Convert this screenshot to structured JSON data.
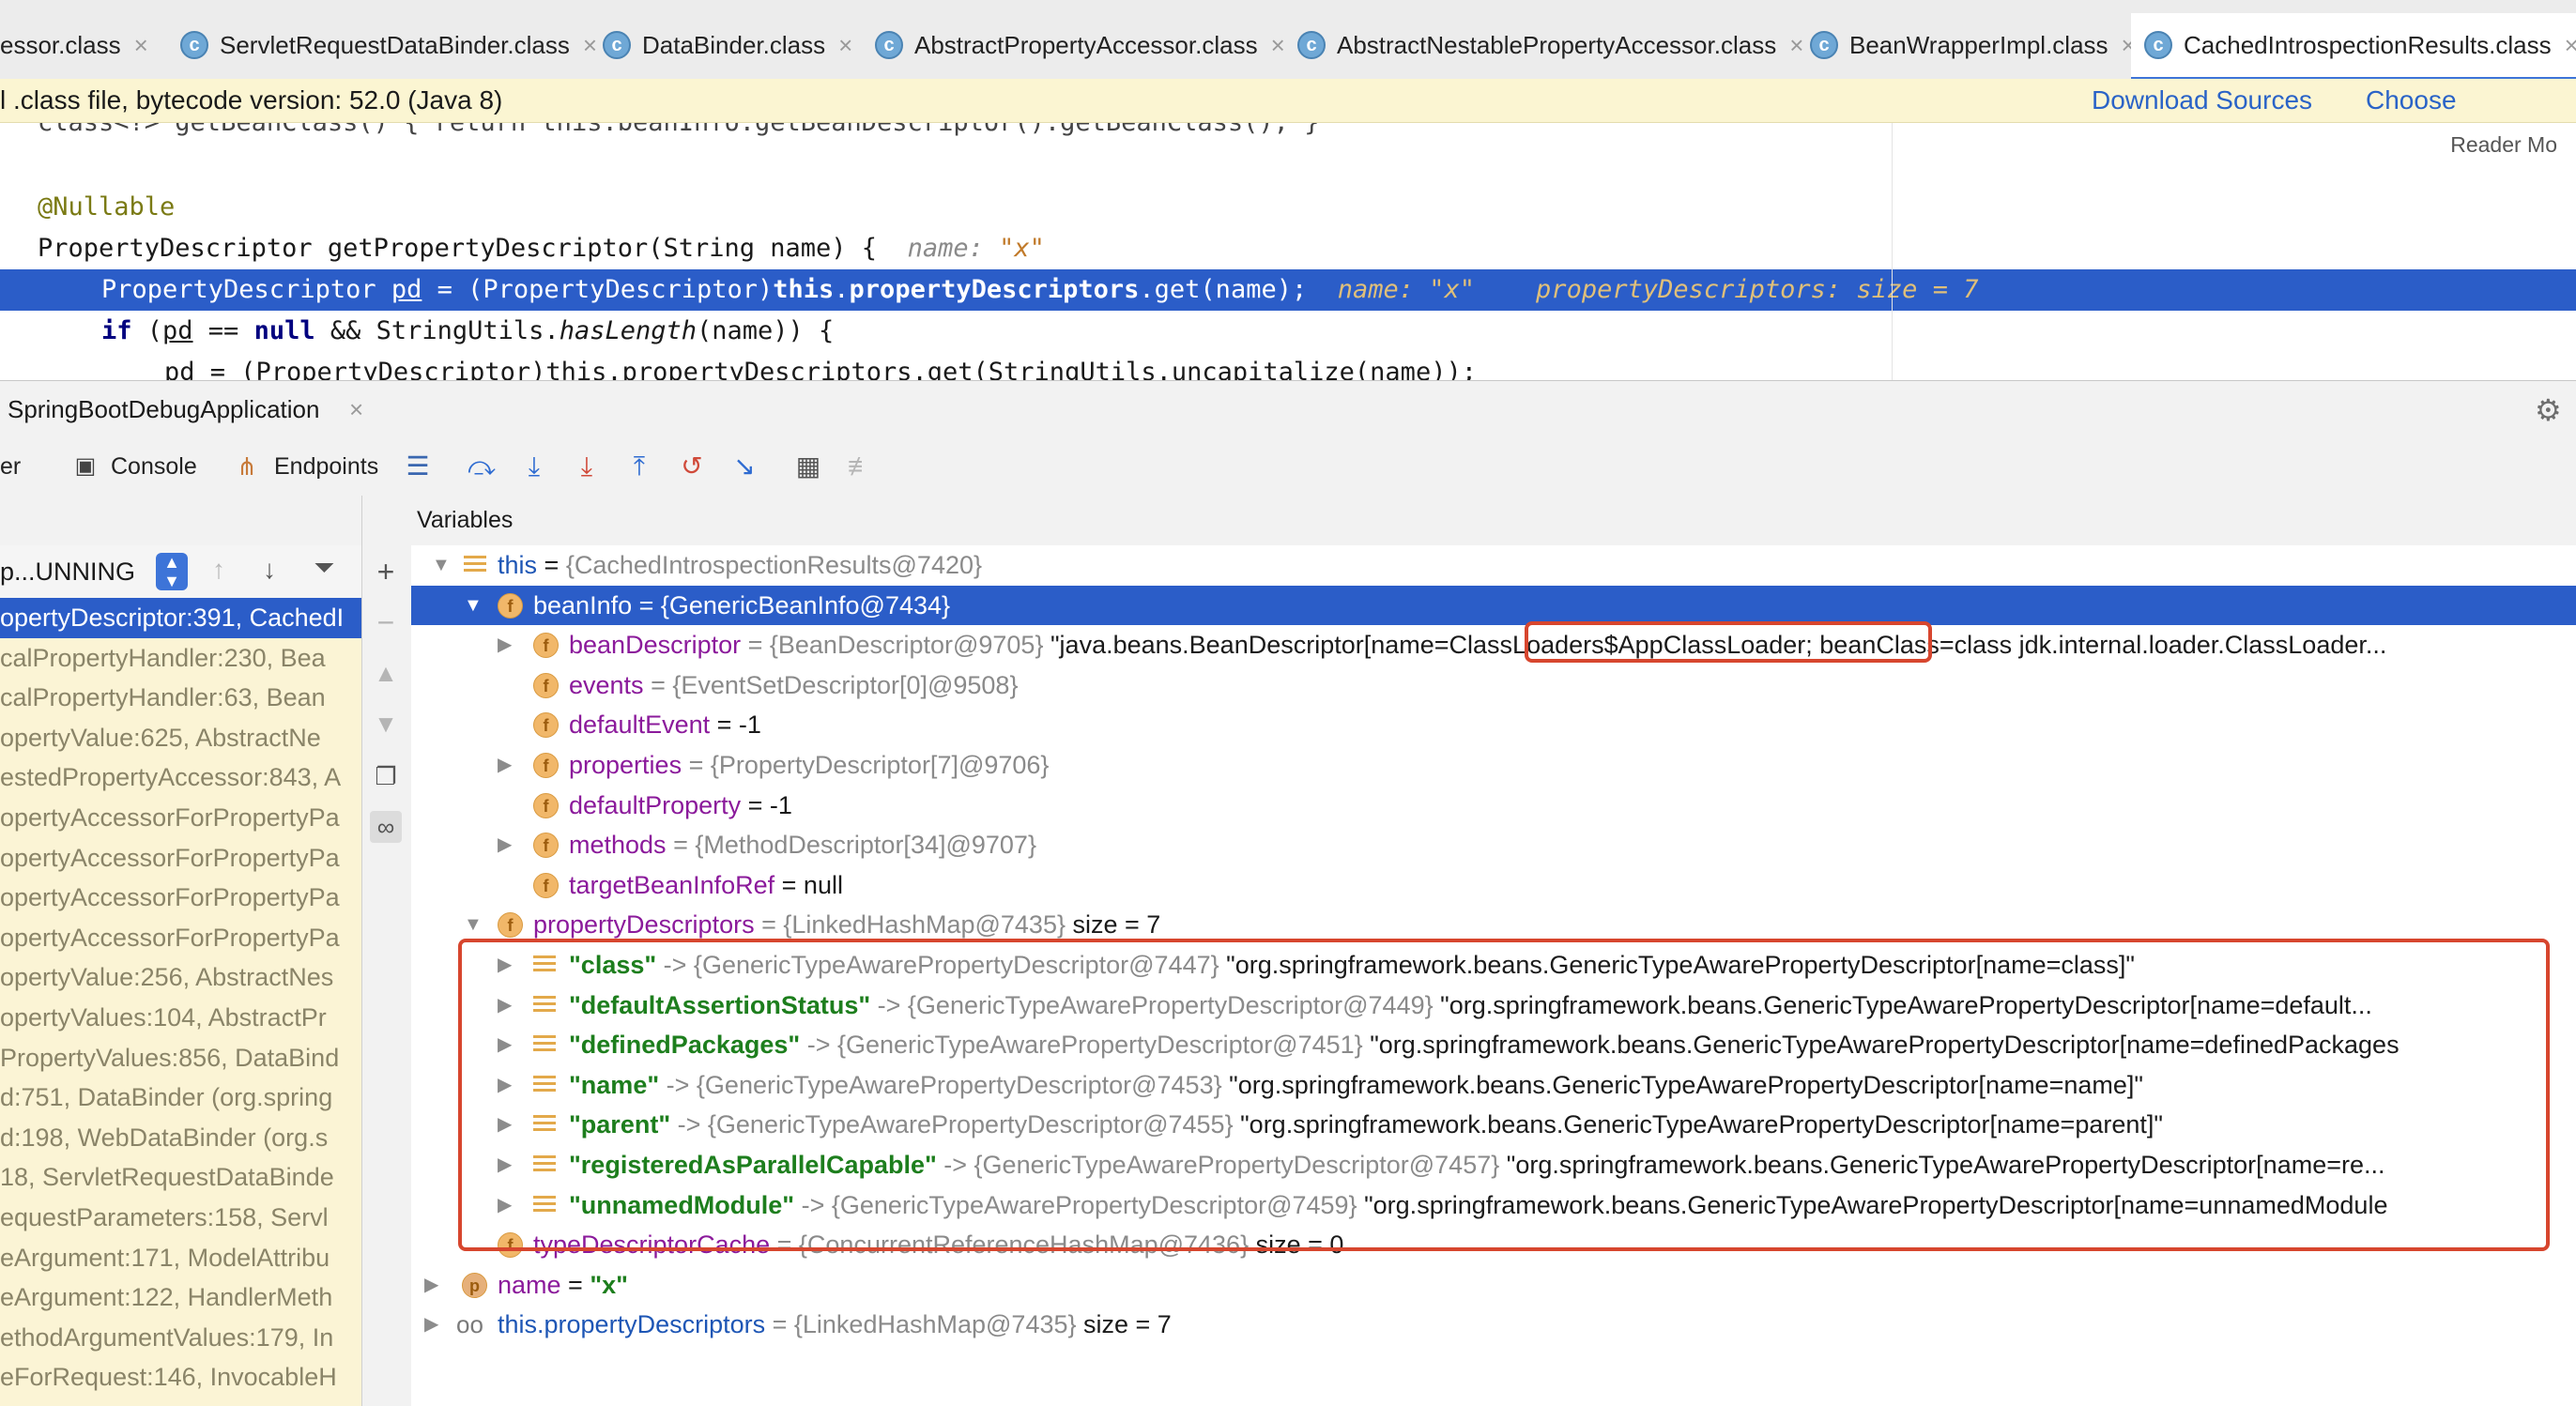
{
  "tabs": [
    {
      "label": "essor.class"
    },
    {
      "label": "ServletRequestDataBinder.class"
    },
    {
      "label": "DataBinder.class"
    },
    {
      "label": "AbstractPropertyAccessor.class"
    },
    {
      "label": "AbstractNestablePropertyAccessor.class"
    },
    {
      "label": "BeanWrapperImpl.class"
    },
    {
      "label": "CachedIntrospectionResults.class"
    }
  ],
  "banner": {
    "text": "l .class file, bytecode version: 52.0 (Java 8)",
    "download_sources": "Download Sources",
    "choose_sources": "Choose Sources..."
  },
  "editor": {
    "reader_mode": "Reader Mo",
    "line0": "class<?> getBeanClass() { return this.beanInfo.getBeanDescriptor().getBeanClass(); }",
    "annotation": "@Nullable",
    "sig": "PropertyDescriptor getPropertyDescriptor(String name) {",
    "sig_hint_name": "name: ",
    "sig_hint_val": "\"x\"",
    "hl_a": "PropertyDescriptor ",
    "hl_b": "pd",
    "hl_c": " = (PropertyDescriptor)",
    "hl_this": "this",
    "hl_dot": ".",
    "hl_field": "propertyDescriptors",
    "hl_d": ".get(name);",
    "hl_hint": "name: \"x\"    propertyDescriptors: size = 7",
    "if_kw": "if",
    "if_a": " (",
    "if_pd": "pd",
    "if_b": " == ",
    "if_null": "null",
    "if_c": " && StringUtils.",
    "if_has": "hasLength",
    "if_d": "(name)) {",
    "line5": "pd = (PropertyDescriptor)this.propertyDescriptors.get(StringUtils.uncapitalize(name));"
  },
  "debug": {
    "session_tab": "SpringBootDebugApplication",
    "toolbar_cut": "er",
    "console": "Console",
    "endpoints": "Endpoints",
    "variables_title": "Variables",
    "thread_state": "p...UNNING"
  },
  "frames": [
    "opertyDescriptor:391, CachedI",
    "calPropertyHandler:230, Bea",
    "calPropertyHandler:63, Bean",
    "opertyValue:625, AbstractNe",
    "estedPropertyAccessor:843, A",
    "opertyAccessorForPropertyPa",
    "opertyAccessorForPropertyPa",
    "opertyAccessorForPropertyPa",
    "opertyAccessorForPropertyPa",
    "opertyValue:256, AbstractNes",
    "opertyValues:104, AbstractPr",
    "PropertyValues:856, DataBind",
    "d:751, DataBinder (org.spring",
    "d:198, WebDataBinder (org.s",
    "18, ServletRequestDataBinde",
    "equestParameters:158, Servl",
    "eArgument:171, ModelAttribu",
    "eArgument:122, HandlerMeth",
    "ethodArgumentValues:179, In",
    "eForRequest:146, InvocableH"
  ],
  "vars": {
    "this_name": "this",
    "this_eq": " = ",
    "this_obj": "{CachedIntrospectionResults@7420}",
    "beaninfo_name": "beanInfo",
    "beaninfo_obj": " = {GenericBeanInfo@7434}",
    "bd_name": "beanDescriptor",
    "bd_obj": " = {BeanDescriptor@9705} ",
    "bd_val_a": "\"java.beans.BeanDescriptor[name",
    "bd_val_b": "=ClassLoaders$AppClassLoader;",
    "bd_val_c": " beanClass=class jdk.internal.loader.ClassLoader...",
    "events_name": "events",
    "events_obj": " = {EventSetDescriptor[0]@9508}",
    "de_name": "defaultEvent",
    "de_val": " = -1",
    "props_name": "properties",
    "props_obj": " = {PropertyDescriptor[7]@9706}",
    "dp_name": "defaultProperty",
    "dp_val": " = -1",
    "methods_name": "methods",
    "methods_obj": " = {MethodDescriptor[34]@9707}",
    "tbir_name": "targetBeanInfoRef",
    "tbir_val": " = null",
    "pds_name": "propertyDescriptors",
    "pds_obj": " = {LinkedHashMap@7435}",
    "pds_size": "  size = 7",
    "entries": [
      {
        "key": "\"class\"",
        "obj": " -> {GenericTypeAwarePropertyDescriptor@7447} ",
        "val": "\"org.springframework.beans.GenericTypeAwarePropertyDescriptor[name=class]\""
      },
      {
        "key": "\"defaultAssertionStatus\"",
        "obj": " -> {GenericTypeAwarePropertyDescriptor@7449} ",
        "val": "\"org.springframework.beans.GenericTypeAwarePropertyDescriptor[name=default..."
      },
      {
        "key": "\"definedPackages\"",
        "obj": " -> {GenericTypeAwarePropertyDescriptor@7451} ",
        "val": "\"org.springframework.beans.GenericTypeAwarePropertyDescriptor[name=definedPackages"
      },
      {
        "key": "\"name\"",
        "obj": " -> {GenericTypeAwarePropertyDescriptor@7453} ",
        "val": "\"org.springframework.beans.GenericTypeAwarePropertyDescriptor[name=name]\""
      },
      {
        "key": "\"parent\"",
        "obj": " -> {GenericTypeAwarePropertyDescriptor@7455} ",
        "val": "\"org.springframework.beans.GenericTypeAwarePropertyDescriptor[name=parent]\""
      },
      {
        "key": "\"registeredAsParallelCapable\"",
        "obj": " -> {GenericTypeAwarePropertyDescriptor@7457} ",
        "val": "\"org.springframework.beans.GenericTypeAwarePropertyDescriptor[name=re..."
      },
      {
        "key": "\"unnamedModule\"",
        "obj": " -> {GenericTypeAwarePropertyDescriptor@7459} ",
        "val": "\"org.springframework.beans.GenericTypeAwarePropertyDescriptor[name=unnamedModule"
      }
    ],
    "tdc_name": "typeDescriptorCache",
    "tdc_obj": " = {ConcurrentReferenceHashMap@7436}",
    "tdc_size": "  size = 0",
    "name_name": "name",
    "name_eq": " = ",
    "name_val": "\"x\"",
    "watch_name": "this.propertyDescriptors",
    "watch_obj": " = {LinkedHashMap@7435}",
    "watch_size": "  size = 7"
  },
  "colors": {
    "selection": "#2b5dc8",
    "highlight_box": "#d7462e",
    "banner_bg": "#fbf5d2",
    "frames_bg": "#fbf4d5"
  }
}
